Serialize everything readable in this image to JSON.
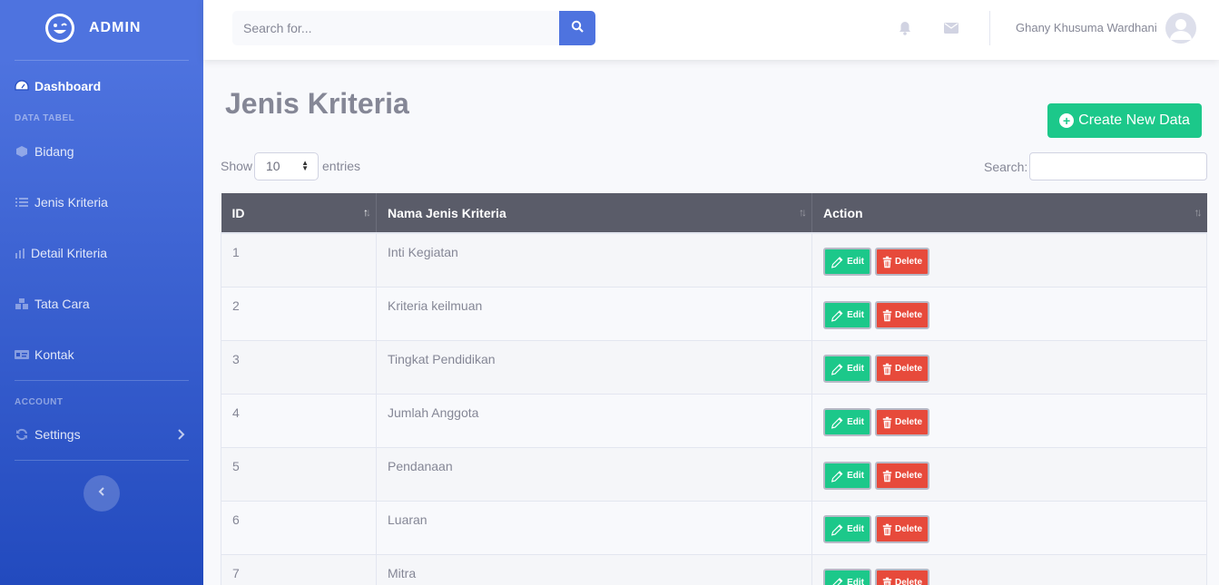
{
  "sidebar": {
    "brand": "ADMIN",
    "items": [
      {
        "label": "Dashboard",
        "icon": "tachometer-icon"
      },
      {
        "label": "Bidang",
        "icon": "cube-icon"
      },
      {
        "label": "Jenis Kriteria",
        "icon": "list-icon"
      },
      {
        "label": "Detail Kriteria",
        "icon": "chart-icon"
      },
      {
        "label": "Tata Cara",
        "icon": "boxes-icon"
      },
      {
        "label": "Kontak",
        "icon": "id-card-icon"
      },
      {
        "label": "Settings",
        "icon": "sync-icon"
      }
    ],
    "headings": {
      "data": "DATA TABEL",
      "account": "ACCOUNT"
    }
  },
  "topbar": {
    "search_placeholder": "Search for...",
    "user_name": "Ghany Khusuma Wardhani"
  },
  "main": {
    "title": "Jenis Kriteria",
    "create_label": "Create New Data",
    "show_label": "Show",
    "entries_value": "10",
    "entries_label": "entries",
    "search_label": "Search:",
    "columns": [
      "ID",
      "Nama Jenis Kriteria",
      "Action"
    ],
    "edit_label": "Edit",
    "delete_label": "Delete",
    "rows": [
      {
        "id": "1",
        "name": "Inti Kegiatan"
      },
      {
        "id": "2",
        "name": "Kriteria keilmuan"
      },
      {
        "id": "3",
        "name": "Tingkat Pendidikan"
      },
      {
        "id": "4",
        "name": "Jumlah Anggota"
      },
      {
        "id": "5",
        "name": "Pendanaan"
      },
      {
        "id": "6",
        "name": "Luaran"
      },
      {
        "id": "7",
        "name": "Mitra"
      }
    ]
  },
  "colors": {
    "primary": "#4e73df",
    "success": "#1cc88a",
    "danger": "#e74a3b",
    "header": "#5a5c69"
  }
}
